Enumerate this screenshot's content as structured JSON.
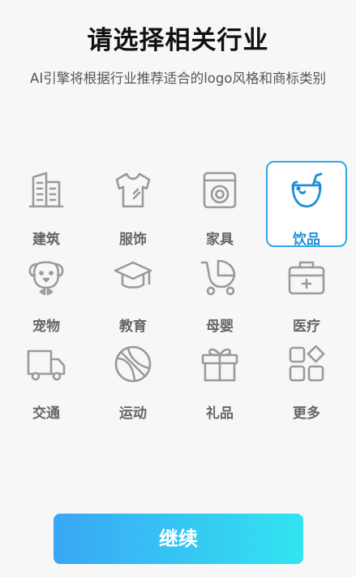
{
  "header": {
    "title": "请选择相关行业",
    "subtitle": "AI引擎将根据行业推荐适合的logo风格和商标类别"
  },
  "colors": {
    "icon_default": "#9a9a9a",
    "icon_selected": "#1f8fd6",
    "selected_border": "#35a7e8",
    "button_gradient_start": "#3aa6f5",
    "button_gradient_end": "#32e4f0"
  },
  "industries": [
    {
      "label": "建筑",
      "icon": "building-icon",
      "selected": false
    },
    {
      "label": "服饰",
      "icon": "tshirt-icon",
      "selected": false
    },
    {
      "label": "家具",
      "icon": "washing-machine-icon",
      "selected": false
    },
    {
      "label": "饮品",
      "icon": "drink-cup-icon",
      "selected": true
    },
    {
      "label": "宠物",
      "icon": "dog-icon",
      "selected": false
    },
    {
      "label": "教育",
      "icon": "graduation-cap-icon",
      "selected": false
    },
    {
      "label": "母婴",
      "icon": "baby-stroller-icon",
      "selected": false
    },
    {
      "label": "医疗",
      "icon": "medical-kit-icon",
      "selected": false
    },
    {
      "label": "交通",
      "icon": "truck-icon",
      "selected": false
    },
    {
      "label": "运动",
      "icon": "basketball-icon",
      "selected": false
    },
    {
      "label": "礼品",
      "icon": "gift-icon",
      "selected": false
    },
    {
      "label": "更多",
      "icon": "more-grid-icon",
      "selected": false
    }
  ],
  "footer": {
    "continue_label": "继续"
  }
}
